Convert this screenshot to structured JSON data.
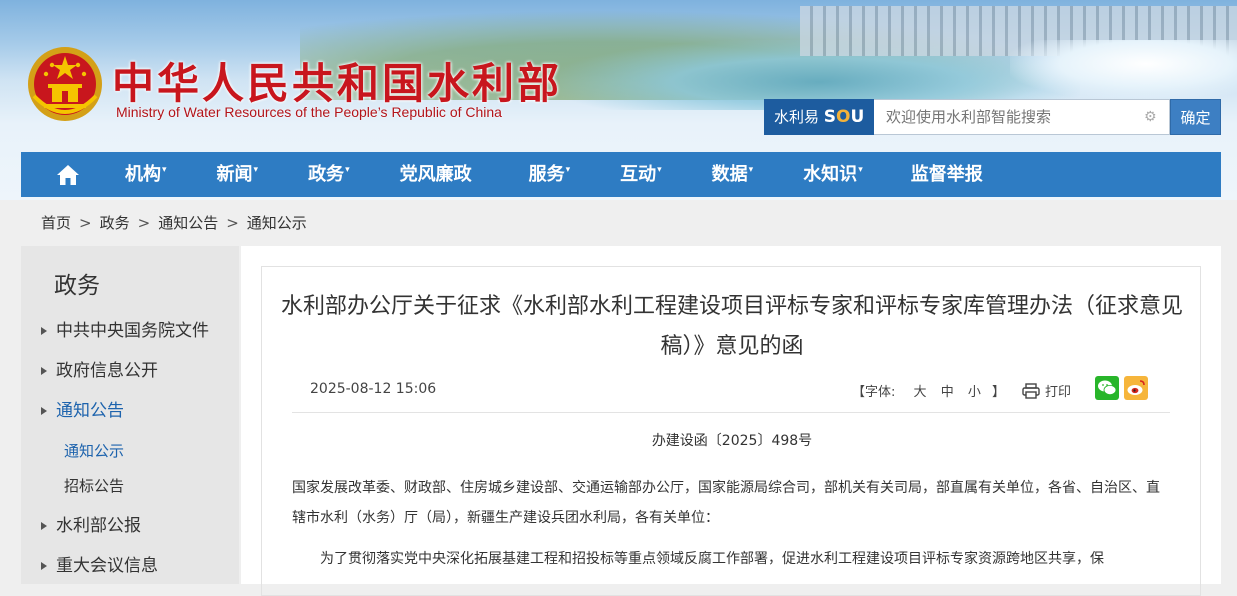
{
  "header": {
    "title": "中华人民共和国水利部",
    "subtitle": "Ministry of Water Resources of the People’s Republic of China"
  },
  "search": {
    "brand_prefix": "水利易",
    "brand_s": "S",
    "brand_o": "O",
    "brand_u": "U",
    "placeholder": "欢迎使用水利部智能搜索",
    "submit_label": "确定"
  },
  "nav": {
    "items": [
      {
        "label": "机构",
        "caret": "▾"
      },
      {
        "label": "新闻",
        "caret": "▾"
      },
      {
        "label": "政务",
        "caret": "▾"
      },
      {
        "label": "党风廉政",
        "caret": ""
      },
      {
        "label": "服务",
        "caret": "▾"
      },
      {
        "label": "互动",
        "caret": "▾"
      },
      {
        "label": "数据",
        "caret": "▾"
      },
      {
        "label": "水知识",
        "caret": "▾"
      },
      {
        "label": "监督举报",
        "caret": ""
      }
    ]
  },
  "breadcrumb": {
    "items": [
      "首页",
      "政务",
      "通知公告",
      "通知公示"
    ],
    "separator": ">"
  },
  "sidebar": {
    "title": "政务",
    "items": [
      {
        "label": "中共中央国务院文件"
      },
      {
        "label": "政府信息公开"
      },
      {
        "label": "通知公告"
      },
      {
        "label": "通知公示"
      },
      {
        "label": "招标公告"
      },
      {
        "label": "水利部公报"
      },
      {
        "label": "重大会议信息"
      }
    ]
  },
  "article": {
    "title": "水利部办公厅关于征求《水利部水利工程建设项目评标专家和评标专家库管理办法（征求意见稿）》意见的函",
    "date": "2025-08-12 15:06",
    "font_label": "【字体:",
    "font_large": "大",
    "font_medium": "中",
    "font_small": "小",
    "font_close": "】",
    "print_label": "打印",
    "doc_number": "办建设函〔2025〕498号",
    "addressee": "国家发展改革委、财政部、住房城乡建设部、交通运输部办公厅，国家能源局综合司，部机关有关司局，部直属有关单位，各省、自治区、直辖市水利（水务）厅（局），新疆生产建设兵团水利局，各有关单位：",
    "paragraph_1": "为了贯彻落实党中央深化拓展基建工程和招投标等重点领域反腐工作部署，促进水利工程建设项目评标专家资源跨地区共享，保"
  },
  "colors": {
    "nav_bg": "#2e7cc3",
    "title_red": "#c8161d",
    "link_blue": "#1d63ad",
    "search_brand_bg": "#1d5c9f"
  },
  "icons": {
    "home": "home-icon",
    "print": "printer-icon",
    "wechat": "wechat-icon",
    "weibo": "weibo-icon",
    "emblem": "national-emblem-icon",
    "search_settings": "gear-icon"
  }
}
